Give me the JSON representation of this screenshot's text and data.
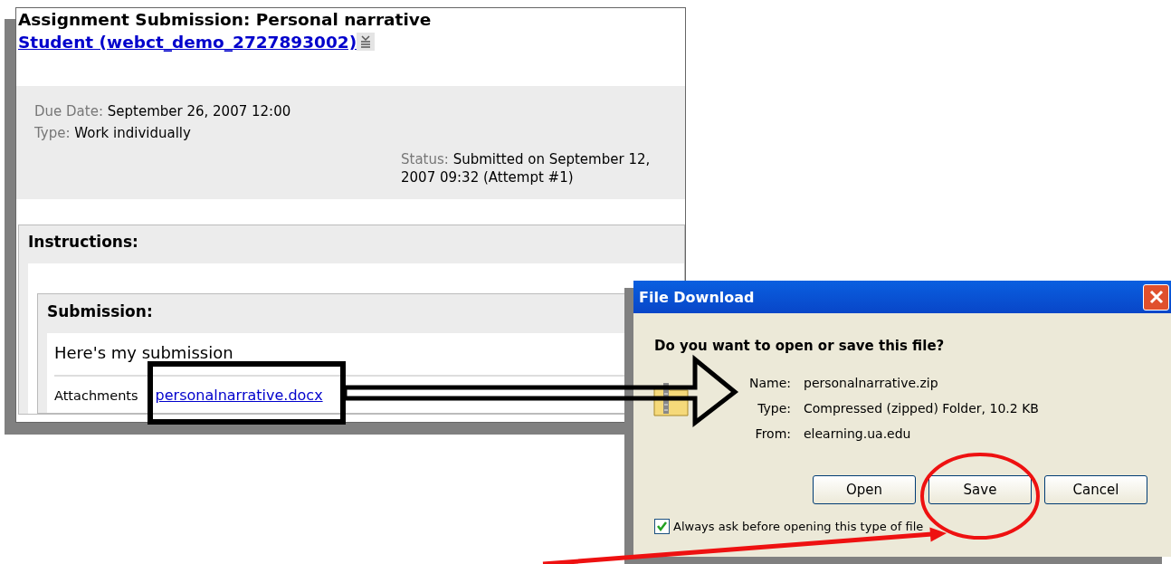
{
  "page": {
    "title": "Assignment Submission: Personal narrative",
    "student_link": "Student (webct_demo_2727893002)",
    "details": [
      {
        "label": "Due Date:",
        "value": "September 26, 2007 12:00"
      },
      {
        "label": "Type:",
        "value": "Work individually"
      }
    ],
    "status": {
      "label": "Status:",
      "value": "Submitted on September 12, 2007 09:32 (Attempt #1)"
    },
    "instructions_heading": "Instructions:",
    "submission_heading": "Submission:",
    "submission_text": "Here's my submission",
    "attachments_label": "Attachments",
    "attachment_link": "personalnarrative.docx"
  },
  "dialog": {
    "title": "File Download",
    "question": "Do you want to open or save this file?",
    "fields": [
      {
        "label": "Name:",
        "value": "personalnarrative.zip"
      },
      {
        "label": "Type:",
        "value": "Compressed (zipped) Folder, 10.2 KB"
      },
      {
        "label": "From:",
        "value": "elearning.ua.edu"
      }
    ],
    "buttons": [
      {
        "label": "Open",
        "circled": false
      },
      {
        "label": "Save",
        "circled": true
      },
      {
        "label": "Cancel",
        "circled": false
      }
    ],
    "always_ask": {
      "label": "Always ask before opening this type of file",
      "checked": true
    }
  }
}
